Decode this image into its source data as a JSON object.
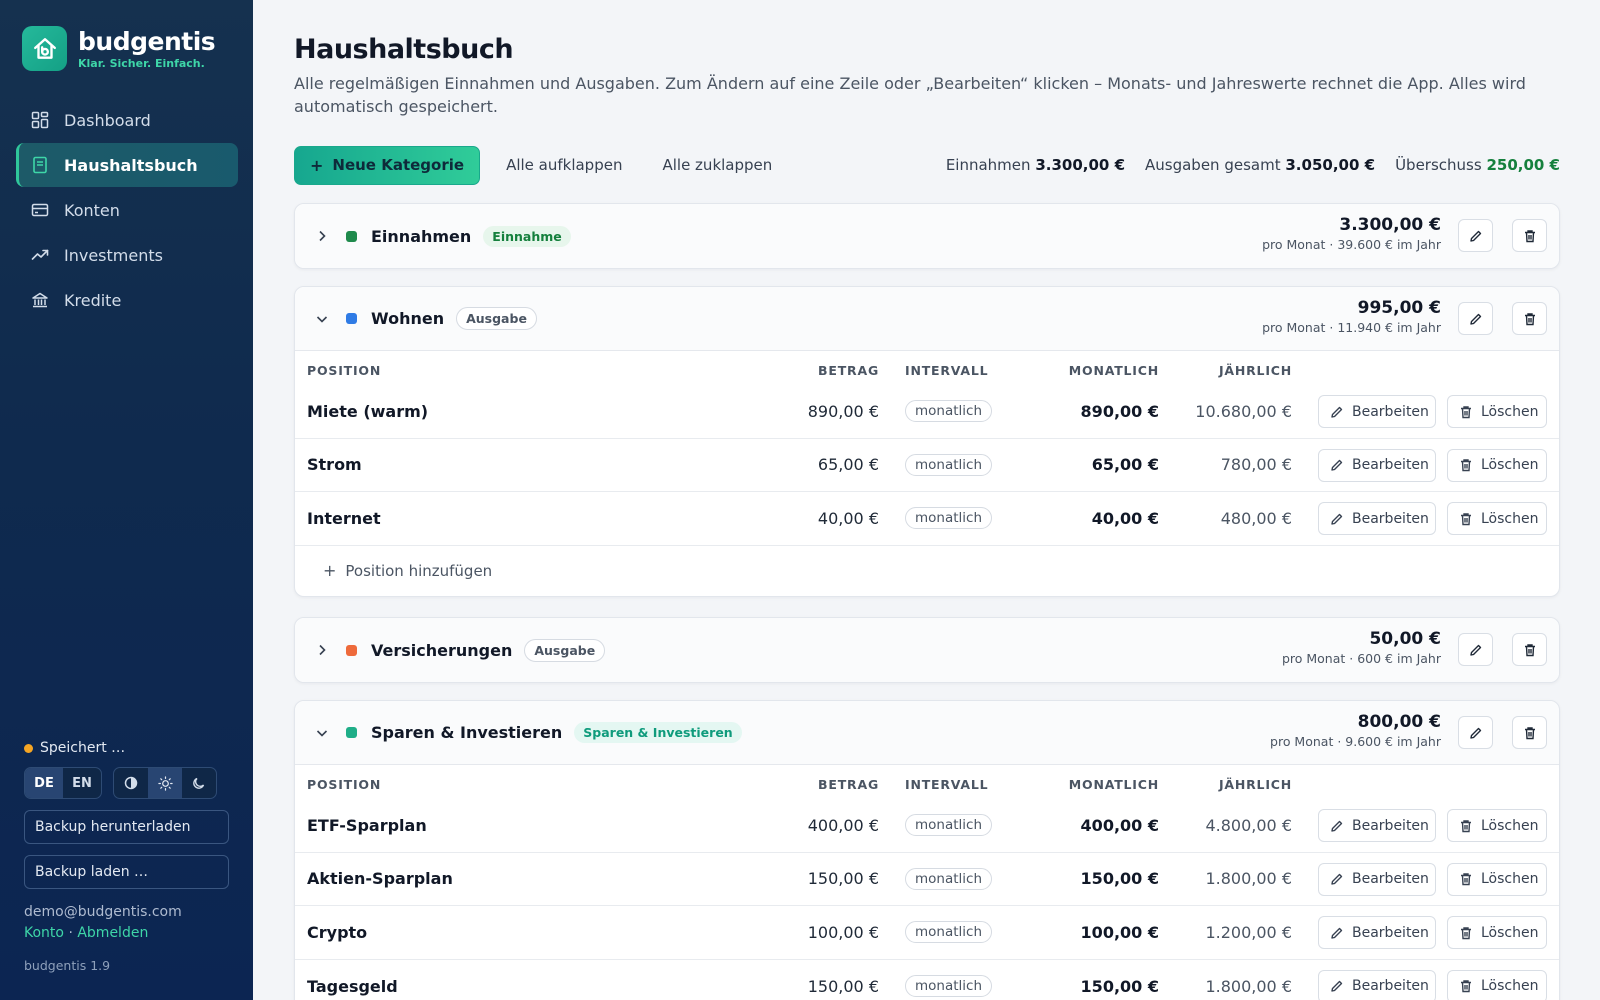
{
  "brand": {
    "name": "budgentis",
    "tagline": "Klar. Sicher. Einfach."
  },
  "nav": [
    {
      "label": "Dashboard",
      "icon": "grid-icon",
      "active": false
    },
    {
      "label": "Haushaltsbuch",
      "icon": "book-icon",
      "active": true
    },
    {
      "label": "Konten",
      "icon": "card-icon",
      "active": false
    },
    {
      "label": "Investments",
      "icon": "trend-icon",
      "active": false
    },
    {
      "label": "Kredite",
      "icon": "bank-icon",
      "active": false
    }
  ],
  "sidebar_footer": {
    "status": "Speichert …",
    "lang": [
      "DE",
      "EN"
    ],
    "lang_selected": "DE",
    "theme_selected": "light",
    "backup_download": "Backup herunterladen",
    "backup_load": "Backup laden …",
    "email": "demo@budgentis.com",
    "account": "Konto",
    "separator": "·",
    "logout": "Abmelden",
    "version": "budgentis 1.9"
  },
  "page": {
    "title": "Haushaltsbuch",
    "subtitle": "Alle regelmäßigen Einnahmen und Ausgaben. Zum Ändern auf eine Zeile oder „Bearbeiten“ klicken – Monats- und Jahreswerte rechnet die App. Alles wird automatisch gespeichert."
  },
  "toolbar": {
    "new_category": "Neue Kategorie",
    "expand_all": "Alle aufklappen",
    "collapse_all": "Alle zuklappen",
    "income_label": "Einnahmen",
    "income_value": "3.300,00 €",
    "expenses_label": "Ausgaben gesamt",
    "expenses_value": "3.050,00 €",
    "surplus_label": "Überschuss",
    "surplus_value": "250,00 €"
  },
  "table_headers": {
    "position": "POSITION",
    "amount": "BETRAG",
    "interval": "INTERVALL",
    "monthly": "MONATLICH",
    "yearly": "JÄHRLICH"
  },
  "row_actions": {
    "edit": "Bearbeiten",
    "delete": "Löschen"
  },
  "add_position": "Position hinzufügen",
  "categories": [
    {
      "name": "Einnahmen",
      "badge": "Einnahme",
      "badge_type": "in",
      "color": "#1f8a4c",
      "amount": "3.300,00 €",
      "meta": "pro Monat · 39.600 € im Jahr",
      "expanded": false
    },
    {
      "name": "Wohnen",
      "badge": "Ausgabe",
      "badge_type": "out",
      "color": "#2f7be5",
      "amount": "995,00 €",
      "meta": "pro Monat · 11.940 € im Jahr",
      "expanded": true,
      "rows": [
        {
          "position": "Miete (warm)",
          "amount": "890,00 €",
          "interval": "monatlich",
          "monthly": "890,00 €",
          "yearly": "10.680,00 €"
        },
        {
          "position": "Strom",
          "amount": "65,00 €",
          "interval": "monatlich",
          "monthly": "65,00 €",
          "yearly": "780,00 €"
        },
        {
          "position": "Internet",
          "amount": "40,00 €",
          "interval": "monatlich",
          "monthly": "40,00 €",
          "yearly": "480,00 €"
        }
      ]
    },
    {
      "name": "Versicherungen",
      "badge": "Ausgabe",
      "badge_type": "out",
      "color": "#ee6a3b",
      "amount": "50,00 €",
      "meta": "pro Monat · 600 € im Jahr",
      "expanded": false
    },
    {
      "name": "Sparen & Investieren",
      "badge": "Sparen & Investieren",
      "badge_type": "save",
      "color": "#1fae88",
      "amount": "800,00 €",
      "meta": "pro Monat · 9.600 € im Jahr",
      "expanded": true,
      "rows": [
        {
          "position": "ETF-Sparplan",
          "amount": "400,00 €",
          "interval": "monatlich",
          "monthly": "400,00 €",
          "yearly": "4.800,00 €"
        },
        {
          "position": "Aktien-Sparplan",
          "amount": "150,00 €",
          "interval": "monatlich",
          "monthly": "150,00 €",
          "yearly": "1.800,00 €"
        },
        {
          "position": "Crypto",
          "amount": "100,00 €",
          "interval": "monatlich",
          "monthly": "100,00 €",
          "yearly": "1.200,00 €"
        },
        {
          "position": "Tagesgeld",
          "amount": "150,00 €",
          "interval": "monatlich",
          "monthly": "150,00 €",
          "yearly": "1.800,00 €"
        }
      ]
    }
  ]
}
